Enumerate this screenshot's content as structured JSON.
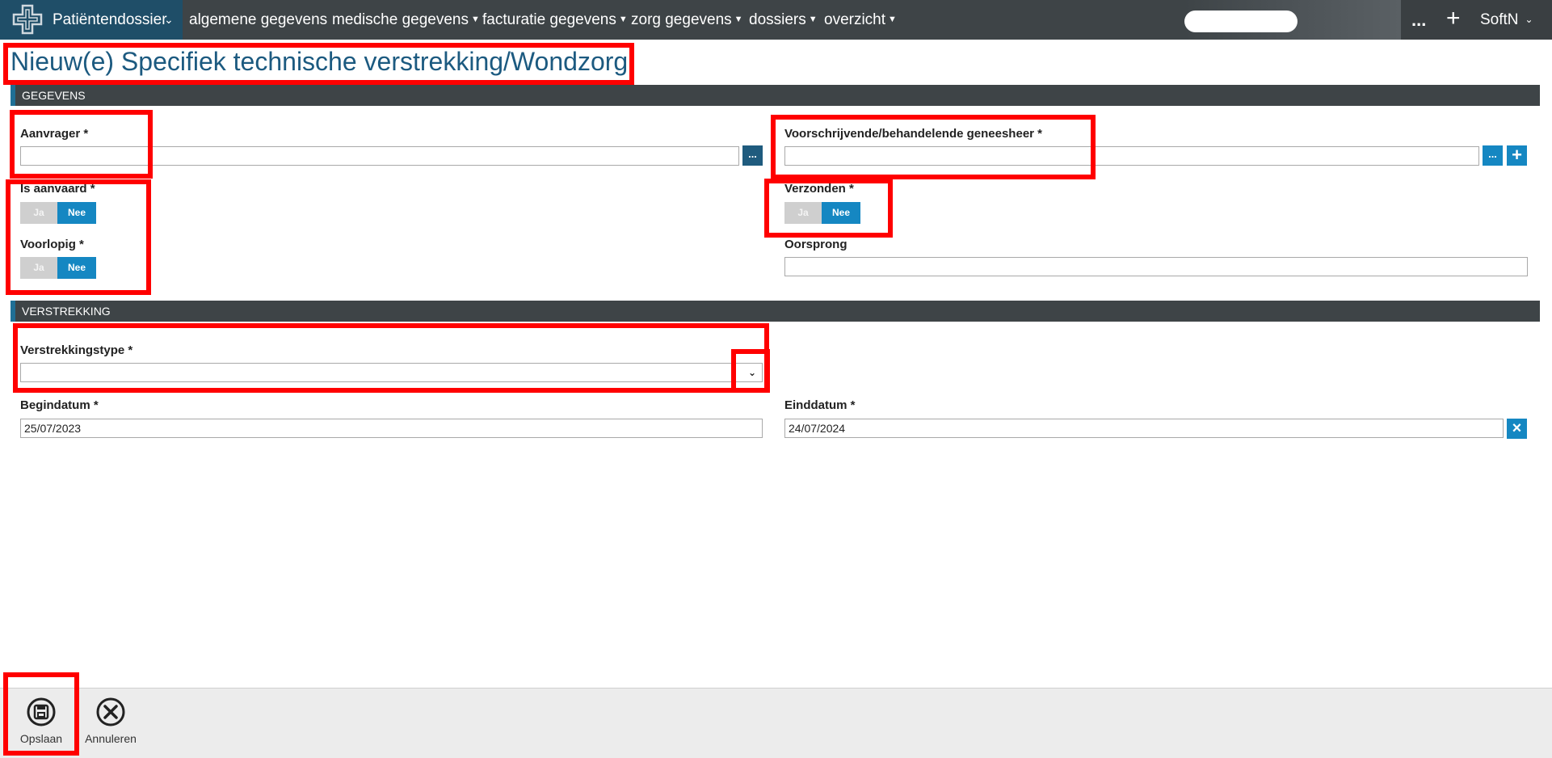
{
  "topbar": {
    "brand_label": "Patiëntendossier",
    "menu": [
      {
        "label": "algemene gegevens",
        "has_dropdown": false
      },
      {
        "label": "medische gegevens",
        "has_dropdown": true
      },
      {
        "label": "facturatie gegevens",
        "has_dropdown": true
      },
      {
        "label": "zorg gegevens",
        "has_dropdown": true
      },
      {
        "label": "dossiers",
        "has_dropdown": true
      },
      {
        "label": "overzicht",
        "has_dropdown": true
      }
    ],
    "search_placeholder": "",
    "more_label": "...",
    "add_label": "+",
    "user_label": "SoftN",
    "colors": {
      "bar": "#3e4447",
      "brand": "#1f4e68"
    }
  },
  "page": {
    "title": "Nieuw(e) Specifiek technische verstrekking/Wondzorg"
  },
  "sections": {
    "gegevens": {
      "header": "GEGEVENS",
      "aanvrager": {
        "label": "Aanvrager *",
        "value": "",
        "lookup_label": "..."
      },
      "geneesheer": {
        "label": "Voorschrijvende/behandelende geneesheer *",
        "value": "",
        "lookup_label": "...",
        "add_label": "+"
      },
      "is_aanvaard": {
        "label": "Is aanvaard *",
        "yes": "Ja",
        "no": "Nee",
        "selected": "Nee"
      },
      "verzonden": {
        "label": "Verzonden *",
        "yes": "Ja",
        "no": "Nee",
        "selected": "Nee"
      },
      "voorlopig": {
        "label": "Voorlopig *",
        "yes": "Ja",
        "no": "Nee",
        "selected": "Nee"
      },
      "oorsprong": {
        "label": "Oorsprong",
        "value": ""
      }
    },
    "verstrekking": {
      "header": "VERSTREKKING",
      "verstrekkingstype": {
        "label": "Verstrekkingstype *",
        "value": ""
      },
      "begindatum": {
        "label": "Begindatum *",
        "value": "25/07/2023"
      },
      "einddatum": {
        "label": "Einddatum *",
        "value": "24/07/2024",
        "clear_label": "×"
      }
    }
  },
  "footer": {
    "save_label": "Opslaan",
    "cancel_label": "Annuleren"
  },
  "accent_colors": {
    "primary": "#1587c2",
    "title": "#1c5a80",
    "annotation": "#ff0000"
  }
}
